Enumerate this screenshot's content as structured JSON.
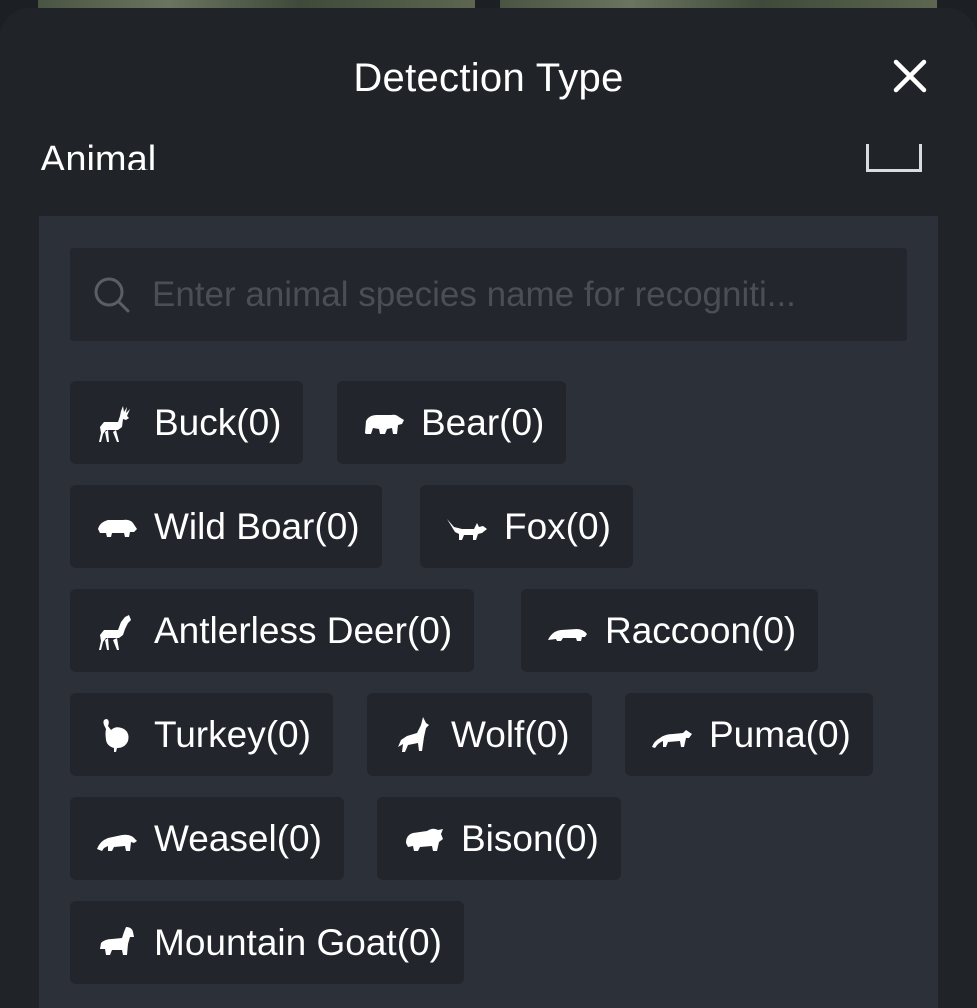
{
  "modal": {
    "title": "Detection Type",
    "close_icon": "close-icon"
  },
  "section": {
    "label": "Animal"
  },
  "search": {
    "placeholder": "Enter animal species name for recogniti...",
    "value": ""
  },
  "species": [
    {
      "label": "Buck(0)",
      "icon": "buck-icon"
    },
    {
      "label": "Bear(0)",
      "icon": "bear-icon"
    },
    {
      "label": "Wild Boar(0)",
      "icon": "wild-boar-icon"
    },
    {
      "label": "Fox(0)",
      "icon": "fox-icon"
    },
    {
      "label": "Antlerless Deer(0)",
      "icon": "antlerless-deer-icon"
    },
    {
      "label": "Raccoon(0)",
      "icon": "raccoon-icon"
    },
    {
      "label": "Turkey(0)",
      "icon": "turkey-icon"
    },
    {
      "label": "Wolf(0)",
      "icon": "wolf-icon"
    },
    {
      "label": "Puma(0)",
      "icon": "puma-icon"
    },
    {
      "label": "Weasel(0)",
      "icon": "weasel-icon"
    },
    {
      "label": "Bison(0)",
      "icon": "bison-icon"
    },
    {
      "label": "Mountain Goat(0)",
      "icon": "mountain-goat-icon"
    }
  ],
  "colors": {
    "sheet_background": "#202328",
    "panel_background": "#2c3039",
    "chip_background": "#22252b",
    "text": "#ffffff",
    "placeholder": "#4a4e56"
  }
}
